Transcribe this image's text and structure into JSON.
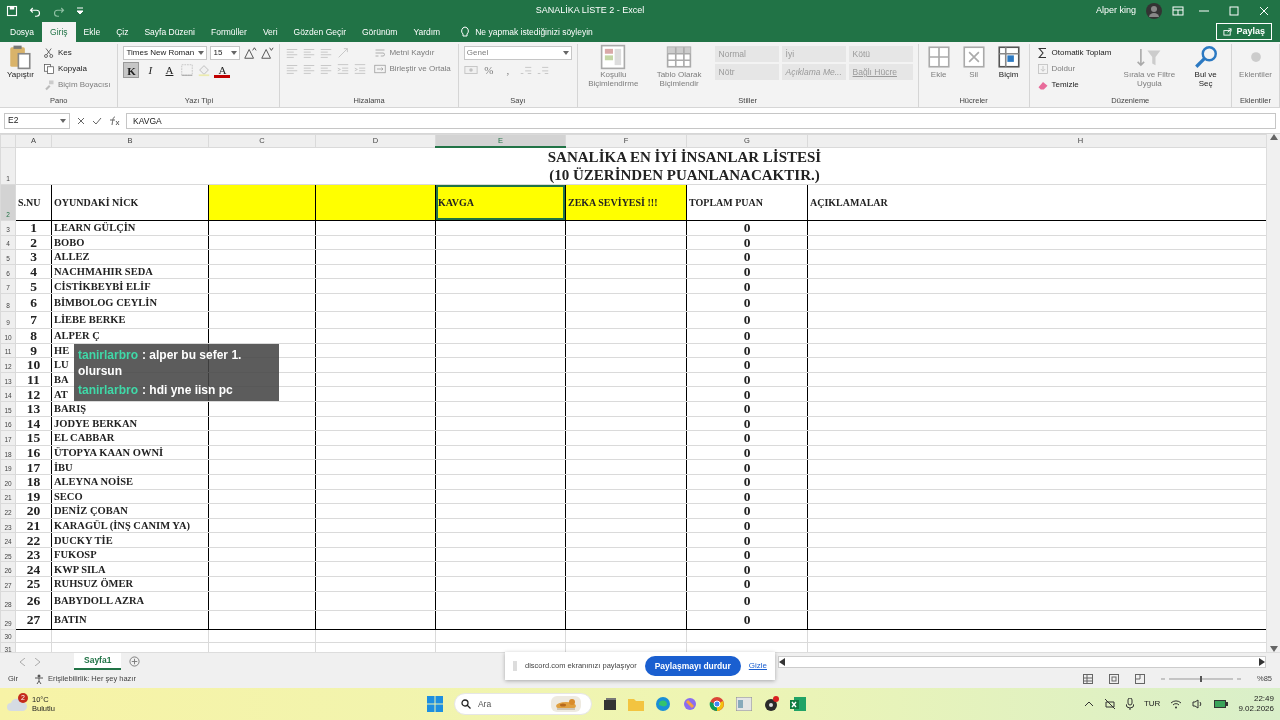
{
  "window": {
    "title": "SANALİKA LİSTE 2  -  Excel",
    "user": "Alper king"
  },
  "ribbon_tabs": [
    {
      "label": "Dosya",
      "selected": false
    },
    {
      "label": "Giriş",
      "selected": true
    },
    {
      "label": "Ekle",
      "selected": false
    },
    {
      "label": "Çiz",
      "selected": false
    },
    {
      "label": "Sayfa Düzeni",
      "selected": false
    },
    {
      "label": "Formüller",
      "selected": false
    },
    {
      "label": "Veri",
      "selected": false
    },
    {
      "label": "Gözden Geçir",
      "selected": false
    },
    {
      "label": "Görünüm",
      "selected": false
    },
    {
      "label": "Yardım",
      "selected": false
    }
  ],
  "tell_me": "Ne yapmak istediğinizi söyleyin",
  "share_button": "Paylaş",
  "ribbon_groups": [
    {
      "title": "Pano",
      "columns": [
        [
          [
            {
              "kind": "large",
              "label": "Yapıştır",
              "disabled": false
            }
          ]
        ],
        [
          [
            {
              "kind": "small",
              "label": "Kes",
              "disabled": false
            }
          ],
          [
            {
              "kind": "small",
              "label": "Kopyala",
              "disabled": false
            }
          ],
          [
            {
              "kind": "small",
              "label": "Biçim Boyacısı",
              "disabled": true
            }
          ]
        ]
      ]
    },
    {
      "title": "Yazı Tipi",
      "columns": [
        [
          [
            {
              "kind": "field",
              "label": "Times New Roman",
              "disabled": false
            },
            {
              "kind": "field",
              "label": "15",
              "disabled": false
            },
            {
              "kind": "icon",
              "disabled": false
            },
            {
              "kind": "icon",
              "disabled": false
            }
          ],
          [
            {
              "kind": "key",
              "label": "K",
              "selected": true,
              "disabled": false
            },
            {
              "kind": "key",
              "label": "I",
              "selected": false,
              "disabled": false
            },
            {
              "kind": "key",
              "label": "A",
              "selected": false,
              "disabled": false
            },
            {
              "kind": "icon",
              "disabled": true
            },
            {
              "kind": "icon",
              "disabled": true
            },
            {
              "kind": "key",
              "label": "A",
              "selected": false,
              "disabled": false
            }
          ]
        ]
      ]
    },
    {
      "title": "Hizalama",
      "columns": [
        [
          [
            {
              "kind": "icon",
              "disabled": true
            },
            {
              "kind": "icon",
              "disabled": true
            },
            {
              "kind": "icon",
              "disabled": true
            },
            {
              "kind": "icon",
              "disabled": true
            }
          ],
          [
            {
              "kind": "icon",
              "disabled": true
            },
            {
              "kind": "icon",
              "disabled": true
            },
            {
              "kind": "icon",
              "disabled": true
            },
            {
              "kind": "icon",
              "disabled": true
            },
            {
              "kind": "icon",
              "disabled": true
            }
          ]
        ],
        [
          [
            {
              "kind": "small",
              "label": "Metni Kaydır",
              "disabled": true
            }
          ],
          [
            {
              "kind": "small",
              "label": "Birleştir ve Ortala",
              "disabled": true
            }
          ]
        ]
      ]
    },
    {
      "title": "Sayı",
      "columns": [
        [
          [
            {
              "kind": "field",
              "label": "Genel",
              "disabled": true
            }
          ],
          [
            {
              "kind": "icon",
              "disabled": true
            },
            {
              "kind": "key",
              "label": "%",
              "selected": false,
              "disabled": true
            },
            {
              "kind": "key",
              "label": ",",
              "selected": false,
              "disabled": true
            },
            {
              "kind": "icon",
              "disabled": true
            },
            {
              "kind": "icon",
              "disabled": true
            }
          ]
        ]
      ]
    },
    {
      "title": "Stiller",
      "columns": [
        [
          [
            {
              "kind": "large",
              "label": "Koşullu Biçimlendirme",
              "disabled": true
            }
          ]
        ],
        [
          [
            {
              "kind": "large",
              "label": "Tablo Olarak Biçimlendir",
              "disabled": true
            }
          ]
        ],
        [
          [
            {
              "kind": "style",
              "label": "Normal"
            },
            {
              "kind": "style",
              "label": "İyi"
            },
            {
              "kind": "style",
              "label": "Kötü"
            }
          ],
          [
            {
              "kind": "style",
              "label": "Nötr"
            },
            {
              "kind": "style",
              "label": "Açıklama Me..."
            },
            {
              "kind": "style",
              "label": "Bağlı Hücre"
            }
          ]
        ]
      ]
    },
    {
      "title": "Hücreler",
      "columns": [
        [
          [
            {
              "kind": "large",
              "label": "Ekle",
              "disabled": true
            }
          ]
        ],
        [
          [
            {
              "kind": "large",
              "label": "Sil",
              "disabled": true
            }
          ]
        ],
        [
          [
            {
              "kind": "large",
              "label": "Biçim",
              "disabled": false
            }
          ]
        ]
      ]
    },
    {
      "title": "Düzenleme",
      "columns": [
        [
          [
            {
              "kind": "small",
              "label": "Otomatik Toplam",
              "disabled": false
            }
          ],
          [
            {
              "kind": "small",
              "label": "Doldur",
              "disabled": true
            }
          ],
          [
            {
              "kind": "small",
              "label": "Temizle",
              "disabled": false
            }
          ]
        ],
        [
          [
            {
              "kind": "large",
              "label": "Sırala ve Filtre Uygula",
              "disabled": true
            }
          ]
        ],
        [
          [
            {
              "kind": "large",
              "label": "Bul ve Seç",
              "disabled": false
            }
          ]
        ]
      ]
    },
    {
      "title": "Eklentiler",
      "columns": [
        [
          [
            {
              "kind": "large",
              "label": "Eklentiler",
              "disabled": true
            }
          ]
        ]
      ]
    }
  ],
  "formula_bar": {
    "name_box": "E2",
    "formula": "KAVGA"
  },
  "sheet": {
    "columns": [
      {
        "label": "A",
        "selected": false
      },
      {
        "label": "B",
        "selected": false
      },
      {
        "label": "C",
        "selected": false
      },
      {
        "label": "D",
        "selected": false
      },
      {
        "label": "E",
        "selected": true
      },
      {
        "label": "F",
        "selected": false
      },
      {
        "label": "G",
        "selected": false
      },
      {
        "label": "H",
        "selected": false
      }
    ],
    "row_headers": [
      {
        "label": "1",
        "selected": false
      },
      {
        "label": "2",
        "selected": true
      },
      {
        "label": "3",
        "selected": false
      },
      {
        "label": "4",
        "selected": false
      },
      {
        "label": "5",
        "selected": false
      },
      {
        "label": "6",
        "selected": false
      },
      {
        "label": "7",
        "selected": false
      },
      {
        "label": "8",
        "selected": false
      },
      {
        "label": "9",
        "selected": false
      },
      {
        "label": "10",
        "selected": false
      },
      {
        "label": "11",
        "selected": false
      },
      {
        "label": "12",
        "selected": false
      },
      {
        "label": "13",
        "selected": false
      },
      {
        "label": "14",
        "selected": false
      },
      {
        "label": "15",
        "selected": false
      },
      {
        "label": "16",
        "selected": false
      },
      {
        "label": "17",
        "selected": false
      },
      {
        "label": "18",
        "selected": false
      },
      {
        "label": "19",
        "selected": false
      },
      {
        "label": "20",
        "selected": false
      },
      {
        "label": "21",
        "selected": false
      },
      {
        "label": "22",
        "selected": false
      },
      {
        "label": "23",
        "selected": false
      },
      {
        "label": "24",
        "selected": false
      },
      {
        "label": "25",
        "selected": false
      },
      {
        "label": "26",
        "selected": false
      },
      {
        "label": "27",
        "selected": false
      },
      {
        "label": "28",
        "selected": false
      },
      {
        "label": "29",
        "selected": false
      },
      {
        "label": "30",
        "selected": false
      },
      {
        "label": "31",
        "selected": false
      }
    ],
    "title_lines": [
      "SANALİKA EN İYİ İNSANLAR LİSTESİ",
      "(10 ÜZERİNDEN PUANLANACAKTIR.)"
    ],
    "header_cells": [
      {
        "text": "S.NU",
        "highlighted": false,
        "selected": false
      },
      {
        "text": "OYUNDAKİ NİCK",
        "highlighted": false,
        "selected": false
      },
      {
        "highlighted": true,
        "selected": false
      },
      {
        "highlighted": true,
        "selected": false
      },
      {
        "text": "KAVGA",
        "highlighted": true,
        "selected": true
      },
      {
        "text": "ZEKA SEVİYESİ !!!",
        "highlighted": true,
        "selected": false
      },
      {
        "text": "TOPLAM PUAN",
        "highlighted": false,
        "selected": false
      },
      {
        "text": "AÇIKLAMALAR",
        "highlighted": false,
        "selected": false
      }
    ],
    "rows": [
      {
        "no": "1",
        "nick": "LEARN GÜLÇİN",
        "total": "0"
      },
      {
        "no": "2",
        "nick": "BOBO",
        "total": "0"
      },
      {
        "no": "3",
        "nick": "ALLEZ",
        "total": "0"
      },
      {
        "no": "4",
        "nick": "NACHMAHIR SEDA",
        "total": "0"
      },
      {
        "no": "5",
        "nick": "CİSTİKBEYBİ ELİF",
        "total": "0"
      },
      {
        "no": "6",
        "nick": "BİMBOLOG CEYLİN",
        "total": "0"
      },
      {
        "no": "7",
        "nick": "LİEBE BERKE",
        "total": "0"
      },
      {
        "no": "8",
        "nick": "ALPER Ç",
        "total": "0"
      },
      {
        "no": "9",
        "nick": "HE",
        "total": "0"
      },
      {
        "no": "10",
        "nick": "LU",
        "total": "0"
      },
      {
        "no": "11",
        "nick": "BA",
        "total": "0"
      },
      {
        "no": "12",
        "nick": "AT",
        "total": "0"
      },
      {
        "no": "13",
        "nick": "BARIŞ",
        "total": "0"
      },
      {
        "no": "14",
        "nick": "JODYE BERKAN",
        "total": "0"
      },
      {
        "no": "15",
        "nick": "EL CABBAR",
        "total": "0"
      },
      {
        "no": "16",
        "nick": "ÜTOPYA KAAN OWNİ",
        "total": "0"
      },
      {
        "no": "17",
        "nick": "İBU",
        "total": "0"
      },
      {
        "no": "18",
        "nick": "ALEYNA NOİSE",
        "total": "0"
      },
      {
        "no": "19",
        "nick": "SECO",
        "total": "0"
      },
      {
        "no": "20",
        "nick": "DENİZ ÇOBAN",
        "total": "0"
      },
      {
        "no": "21",
        "nick": "KARAGÜL (İNŞ CANIM YA)",
        "total": "0"
      },
      {
        "no": "22",
        "nick": "DUCKY TİE",
        "total": "0"
      },
      {
        "no": "23",
        "nick": "FUKOSP",
        "total": "0"
      },
      {
        "no": "24",
        "nick": "KWP SILA",
        "total": "0"
      },
      {
        "no": "25",
        "nick": "RUHSUZ ÖMER",
        "total": "0"
      },
      {
        "no": "26",
        "nick": "BABYDOLL AZRA",
        "total": "0"
      },
      {
        "no": "27",
        "nick": "BATIN",
        "total": "0"
      }
    ]
  },
  "chat_overlay": [
    {
      "user": "tanirlarbro",
      "text": ": alper bu sefer 1. olursun"
    },
    {
      "user": "tanirlarbro",
      "text": ": hdi yne iisn pc"
    }
  ],
  "sheet_tabs": [
    {
      "label": "Sayfa1",
      "selected": true
    }
  ],
  "status_bar": {
    "mode": "Gir",
    "accessibility": "Erişilebilirlik: Her şey hazır",
    "zoom_slider": {
      "level": 0.5
    },
    "zoom": "%85"
  },
  "screen_share": {
    "message": "discord.com ekranınızı paylaşıyor",
    "stop_button": "Paylaşmayı durdur",
    "hide_link": "Gizle"
  },
  "taskbar": {
    "temperature": "10°C",
    "weather": "Bulutlu",
    "weather_badge": "2",
    "search": {
      "placeholder": "Ara"
    },
    "language": "TUR",
    "time": "22:49",
    "date": "9.02.2026"
  }
}
